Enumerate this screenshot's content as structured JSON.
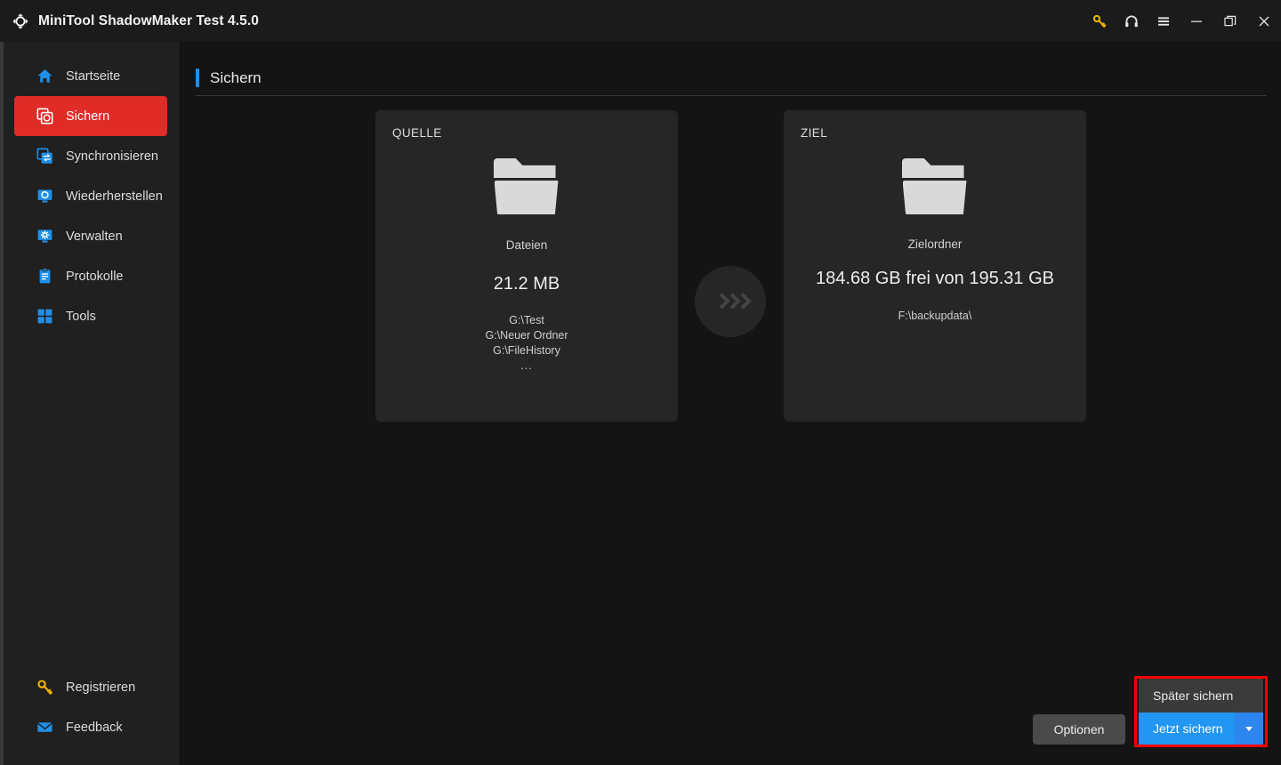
{
  "window": {
    "title": "MiniTool ShadowMaker Test 4.5.0",
    "logo_icon": "refresh-arrows-icon",
    "controls": [
      {
        "name": "license-key-icon",
        "glyph": "key"
      },
      {
        "name": "support-headset-icon",
        "glyph": "headset"
      },
      {
        "name": "menu-hamburger-icon",
        "glyph": "menu"
      },
      {
        "name": "minimize-icon",
        "glyph": "minimize"
      },
      {
        "name": "restore-icon",
        "glyph": "restore"
      },
      {
        "name": "close-icon",
        "glyph": "close"
      }
    ]
  },
  "sidebar": {
    "items": [
      {
        "label": "Startseite",
        "icon": "home-icon",
        "active": false
      },
      {
        "label": "Sichern",
        "icon": "backup-icon",
        "active": true
      },
      {
        "label": "Synchronisieren",
        "icon": "sync-icon",
        "active": false
      },
      {
        "label": "Wiederherstellen",
        "icon": "restore-monitor-icon",
        "active": false
      },
      {
        "label": "Verwalten",
        "icon": "manage-gear-monitor-icon",
        "active": false
      },
      {
        "label": "Protokolle",
        "icon": "logs-clipboard-icon",
        "active": false
      },
      {
        "label": "Tools",
        "icon": "tools-grid-icon",
        "active": false
      }
    ],
    "bottom_items": [
      {
        "label": "Registrieren",
        "icon": "key-icon"
      },
      {
        "label": "Feedback",
        "icon": "envelope-icon"
      }
    ]
  },
  "page": {
    "title": "Sichern",
    "accent_color": "#1f8fe8"
  },
  "source_card": {
    "kicker": "QUELLE",
    "icon": "folder-icon",
    "type": "Dateien",
    "size": "21.2 MB",
    "paths": [
      "G:\\Test",
      "G:\\Neuer Ordner",
      "G:\\FileHistory"
    ],
    "more": "..."
  },
  "arrow": {
    "icon": "chevrons-right-icon"
  },
  "target_card": {
    "kicker": "ZIEL",
    "icon": "folder-icon",
    "type": "Zielordner",
    "capacity": "184.68 GB frei von 195.31 GB",
    "path": "F:\\backupdata\\"
  },
  "footer": {
    "options_label": "Optionen",
    "later_label": "Später sichern",
    "backup_now_label": "Jetzt sichern",
    "dropdown_icon": "chevron-down-icon",
    "highlight_color": "#f40000",
    "primary_color": "#2196f3"
  }
}
